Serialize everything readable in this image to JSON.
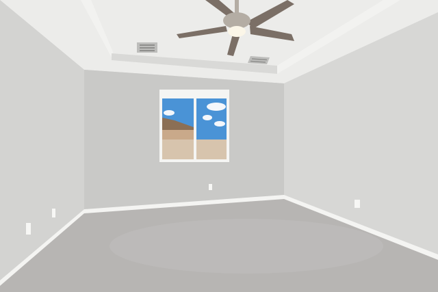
{
  "scene": {
    "subject": "empty-room",
    "palette": {
      "ceiling": "#ececea",
      "ceiling_shadow": "#d9d9d7",
      "tray": "#f2f2f0",
      "wall_left": "#d3d3d1",
      "wall_back": "#c9c9c7",
      "wall_right": "#d7d7d5",
      "baseboard": "#f4f4f2",
      "carpet": "#b7b5b3",
      "carpet_light": "#c4c2c0",
      "window_frame": "#f5f5f3",
      "sky": "#4a93d6",
      "cloud": "#f4f7fb",
      "fence": "#d7c4ad",
      "roof": "#8b6f55",
      "house": "#c9a98a",
      "fan_metal": "#b4ada4",
      "fan_blade": "#7b6f66",
      "fan_light": "#fbf6e8",
      "vent": "#bdbdbb",
      "outlet": "#f7f7f5"
    }
  }
}
